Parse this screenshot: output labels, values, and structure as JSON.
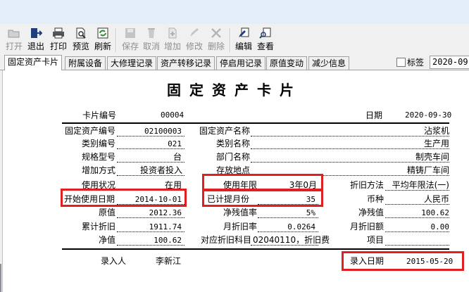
{
  "toolbar": {
    "buttons": [
      {
        "label": "打开",
        "icon": "open-folder-icon",
        "enabled": false
      },
      {
        "label": "退出",
        "icon": "exit-door-icon",
        "enabled": true
      },
      {
        "label": "打印",
        "icon": "printer-icon",
        "enabled": true
      },
      {
        "label": "预览",
        "icon": "print-preview-icon",
        "enabled": true
      },
      {
        "label": "刷新",
        "icon": "refresh-icon",
        "enabled": true
      },
      {
        "label": "保存",
        "icon": "save-disk-icon",
        "enabled": false
      },
      {
        "label": "取消",
        "icon": "cancel-icon",
        "enabled": false
      },
      {
        "label": "增加",
        "icon": "add-icon",
        "enabled": false
      },
      {
        "label": "修改",
        "icon": "edit-pencil-icon",
        "enabled": false
      },
      {
        "label": "删除",
        "icon": "delete-x-icon",
        "enabled": false
      },
      {
        "label": "编辑",
        "icon": "edit-doc-icon",
        "enabled": true
      },
      {
        "label": "查看",
        "icon": "view-doc-icon",
        "enabled": true
      }
    ]
  },
  "tabs": [
    "固定资产卡片",
    "附属设备",
    "大修理记录",
    "资产转移记录",
    "停启用记录",
    "原值变动",
    "减少信息"
  ],
  "tag_checkbox_label": "标签",
  "header_date": "2020-09-",
  "card": {
    "title": "固定资产卡片",
    "card_no_label": "卡片编号",
    "card_no": "00004",
    "date_label": "日期",
    "date": "2020-09-30",
    "fields": {
      "asset_code_label": "固定资产编号",
      "asset_code": "02100003",
      "asset_name_label": "固定资产名称",
      "asset_name": "沾浆机",
      "category_code_label": "类别编号",
      "category_code": "021",
      "category_name_label": "类别名称",
      "category_name": "生产用",
      "spec_label": "规格型号",
      "spec": "台",
      "dept_label": "部门名称",
      "dept": "制壳车间",
      "add_method_label": "增加方式",
      "add_method": "投资者投入",
      "location_label": "存放地点",
      "location": "精铸厂车间",
      "status_label": "使用状况",
      "status": "在用",
      "life_label": "使用年限",
      "life": "3年0月",
      "dep_method_label": "折旧方法",
      "dep_method": "平均年限法(一)",
      "start_date_label": "开始使用日期",
      "start_date": "2014-10-01",
      "months_label": "已计提月份",
      "months": "35",
      "currency_label": "币种",
      "currency": "人民币",
      "original_label": "原值",
      "original": "2012.36",
      "salvage_rate_label": "净残值率",
      "salvage_rate": "5%",
      "salvage_label": "净残值",
      "salvage": "100.62",
      "acc_dep_label": "累计折旧",
      "acc_dep": "1911.74",
      "monthly_rate_label": "月折旧率",
      "monthly_rate": "0.0264",
      "monthly_dep_label": "月折旧额",
      "monthly_dep": "0.00",
      "net_label": "净值",
      "net": "100.62",
      "dep_account_label": "对应折旧科目",
      "dep_account": "02040110，折旧费",
      "project_label": "项目",
      "project": ""
    },
    "recorder_label": "录入人",
    "recorder": "李新江",
    "entry_date_label": "录入日期",
    "entry_date": "2015-05-20"
  }
}
